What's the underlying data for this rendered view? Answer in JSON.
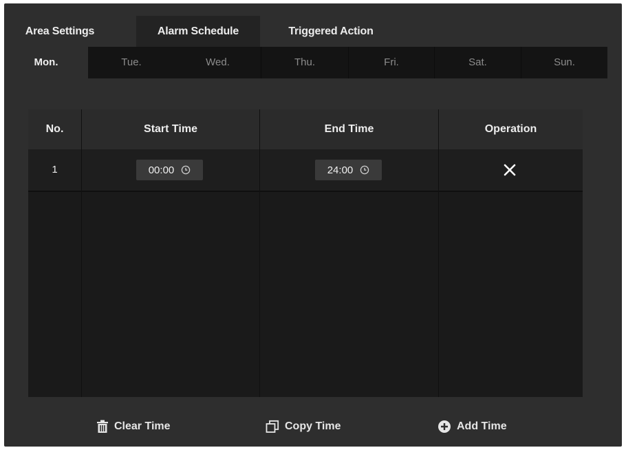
{
  "top_tabs": [
    {
      "label": "Area Settings"
    },
    {
      "label": "Alarm Schedule"
    },
    {
      "label": "Triggered Action"
    }
  ],
  "active_top_tab": "Alarm Schedule",
  "days": [
    {
      "label": "Mon."
    },
    {
      "label": "Tue."
    },
    {
      "label": "Wed."
    },
    {
      "label": "Thu."
    },
    {
      "label": "Fri."
    },
    {
      "label": "Sat."
    },
    {
      "label": "Sun."
    }
  ],
  "active_day": "Mon.",
  "table": {
    "headers": {
      "no": "No.",
      "start": "Start Time",
      "end": "End Time",
      "operation": "Operation"
    },
    "rows": [
      {
        "no": "1",
        "start": "00:00",
        "end": "24:00"
      }
    ]
  },
  "actions": {
    "clear": "Clear Time",
    "copy": "Copy Time",
    "add": "Add Time"
  },
  "icons": {
    "time": "clock-icon",
    "delete": "close-icon",
    "clear": "trash-icon",
    "copy": "copy-icon",
    "add": "plus-circle-icon"
  }
}
